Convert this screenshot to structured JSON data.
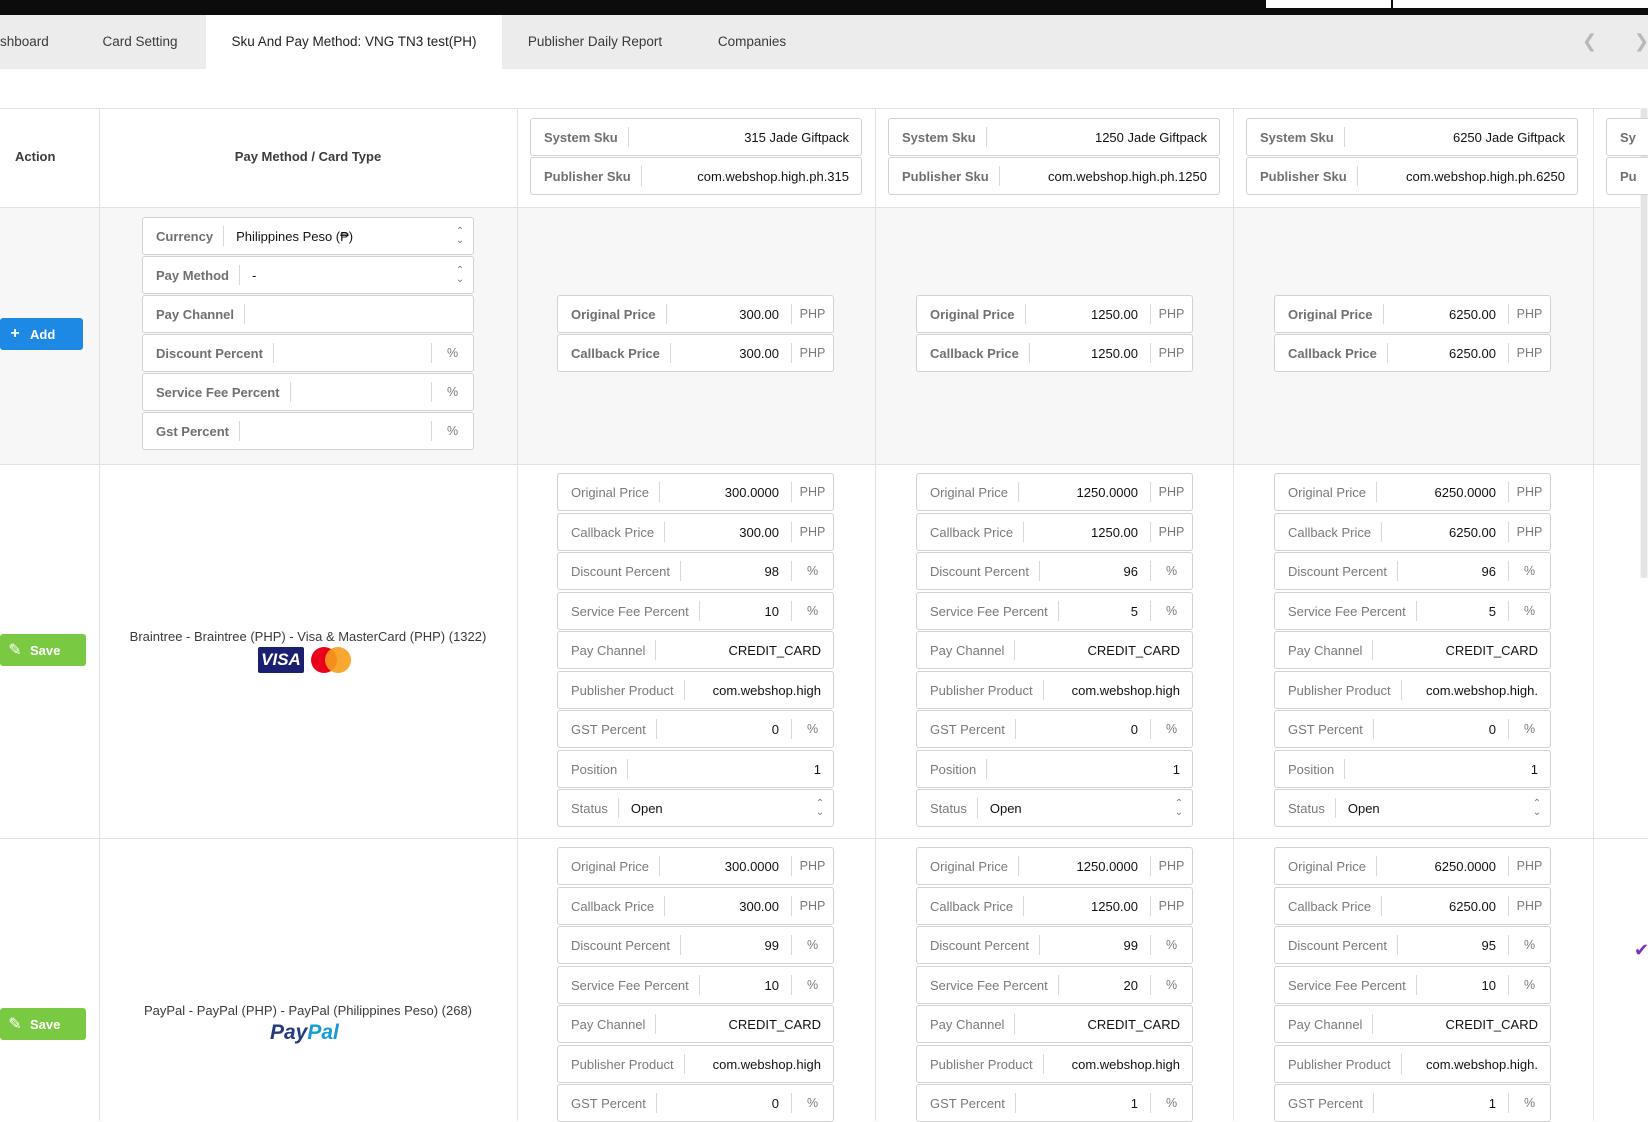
{
  "tabs": [
    {
      "label": "shboard"
    },
    {
      "label": "Card Setting"
    },
    {
      "label": "Sku And Pay Method: VNG TN3 test(PH)"
    },
    {
      "label": "Publisher Daily Report"
    },
    {
      "label": "Companies"
    }
  ],
  "header": {
    "action_label": "Action",
    "pay_method_label": "Pay Method / Card Type",
    "system_sku_label": "System Sku",
    "publisher_sku_label": "Publisher Sku",
    "sku_partial_1": "Sy",
    "sku_partial_2": "Pu"
  },
  "skus": [
    {
      "system": "315 Jade Giftpack",
      "publisher": "com.webshop.high.ph.315"
    },
    {
      "system": "1250 Jade Giftpack",
      "publisher": "com.webshop.high.ph.1250"
    },
    {
      "system": "6250 Jade Giftpack",
      "publisher": "com.webshop.high.ph.6250"
    }
  ],
  "add_row": {
    "add_button": "Add",
    "currency_label": "Currency",
    "currency_value": "Philippines Peso (₱)",
    "pay_method_label": "Pay Method",
    "pay_method_value": "-",
    "pay_channel_label": "Pay Channel",
    "discount_label": "Discount Percent",
    "service_fee_label": "Service Fee Percent",
    "gst_label": "Gst Percent",
    "percent_unit": "%",
    "original_price_label": "Original Price",
    "callback_price_label": "Callback Price",
    "currency_unit": "PHP",
    "prices": [
      {
        "original": "300.00",
        "callback": "300.00"
      },
      {
        "original": "1250.00",
        "callback": "1250.00"
      },
      {
        "original": "6250.00",
        "callback": "6250.00"
      }
    ]
  },
  "labels": {
    "original_price": "Original Price",
    "callback_price": "Callback Price",
    "discount_percent": "Discount Percent",
    "service_fee_percent": "Service Fee Percent",
    "pay_channel": "Pay Channel",
    "publisher_product": "Publisher Product",
    "gst_percent": "GST Percent",
    "position": "Position",
    "status": "Status",
    "php": "PHP",
    "pct": "%",
    "save": "Save"
  },
  "methods": [
    {
      "name": "Braintree - Braintree (PHP) - Visa & MasterCard (PHP) (1322)",
      "visa_text": "VISA",
      "cols": [
        {
          "original": "300.0000",
          "callback": "300.00",
          "discount": "98",
          "service_fee": "10",
          "pay_channel": "CREDIT_CARD",
          "publisher_product": "com.webshop.high",
          "gst": "0",
          "position": "1",
          "status": "Open"
        },
        {
          "original": "1250.0000",
          "callback": "1250.00",
          "discount": "96",
          "service_fee": "5",
          "pay_channel": "CREDIT_CARD",
          "publisher_product": "com.webshop.high",
          "gst": "0",
          "position": "1",
          "status": "Open"
        },
        {
          "original": "6250.0000",
          "callback": "6250.00",
          "discount": "96",
          "service_fee": "5",
          "pay_channel": "CREDIT_CARD",
          "publisher_product": "com.webshop.high.",
          "gst": "0",
          "position": "1",
          "status": "Open"
        }
      ]
    },
    {
      "name": "PayPal - PayPal (PHP) - PayPal (Philippines Peso) (268)",
      "paypal_a": "Pay",
      "paypal_b": "Pal",
      "cols": [
        {
          "original": "300.0000",
          "callback": "300.00",
          "discount": "99",
          "service_fee": "10",
          "pay_channel": "CREDIT_CARD",
          "publisher_product": "com.webshop.high",
          "gst": "0"
        },
        {
          "original": "1250.0000",
          "callback": "1250.00",
          "discount": "99",
          "service_fee": "20",
          "pay_channel": "CREDIT_CARD",
          "publisher_product": "com.webshop.high",
          "gst": "1"
        },
        {
          "original": "6250.0000",
          "callback": "6250.00",
          "discount": "95",
          "service_fee": "10",
          "pay_channel": "CREDIT_CARD",
          "publisher_product": "com.webshop.high.",
          "gst": "1"
        }
      ]
    }
  ],
  "colors": {
    "add_button": "#1e88e5",
    "save_button": "#7ac943",
    "visa": "#1a1f71",
    "paypal_dark": "#253b80",
    "paypal_light": "#179bd7"
  }
}
